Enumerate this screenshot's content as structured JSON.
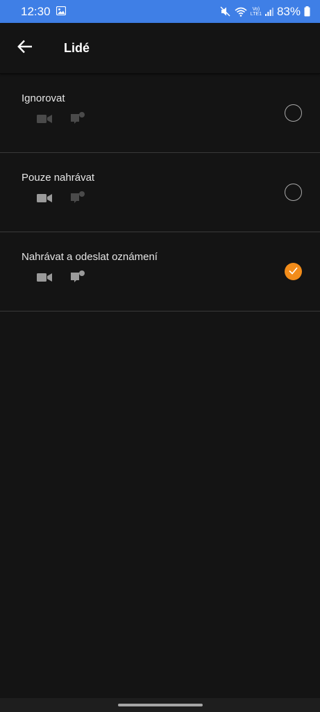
{
  "status_bar": {
    "time": "12:30",
    "battery": "83%",
    "volte_line1": "Vo)",
    "volte_line2": "LTE1",
    "icons": [
      "image-icon",
      "mute-icon",
      "wifi-icon",
      "signal-icon",
      "battery-icon"
    ]
  },
  "appbar": {
    "title": "Lidé",
    "back_icon": "arrow-left-icon"
  },
  "options": [
    {
      "label": "Ignorovat",
      "selected": false,
      "icons_active": false
    },
    {
      "label": "Pouze nahrávat",
      "selected": false,
      "icons_active": false
    },
    {
      "label": "Nahrávat a odeslat oznámení",
      "selected": true,
      "icons_active": true
    }
  ],
  "colors": {
    "status_bar": "#3f7fe6",
    "background": "#141414",
    "accent": "#f28c1a",
    "divider": "#3a3a3a"
  }
}
